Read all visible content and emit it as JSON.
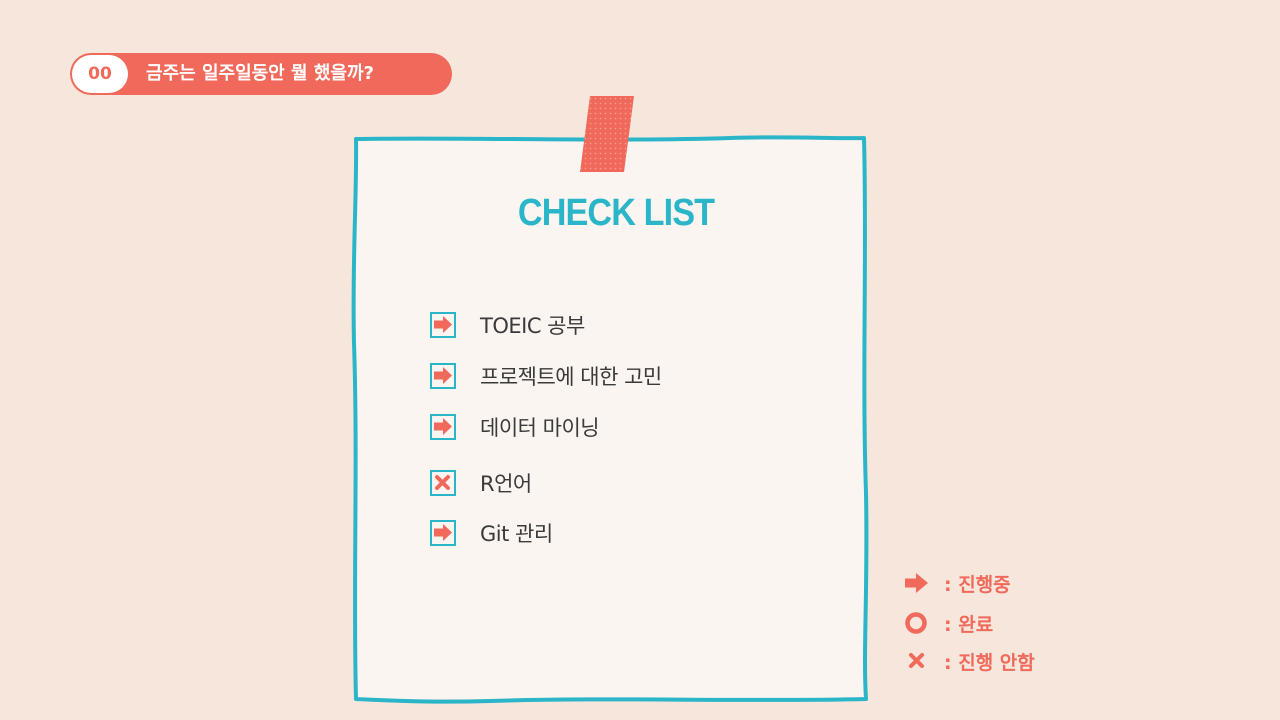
{
  "header": {
    "number": "00",
    "title": "금주는 일주일동안 뭘 했을까?"
  },
  "checklist": {
    "title": "CHECK LIST",
    "items": [
      {
        "label": "TOEIC 공부",
        "status": "in-progress",
        "icon": "arrow-right-icon"
      },
      {
        "label": "프로젝트에 대한 고민",
        "status": "in-progress",
        "icon": "arrow-right-icon"
      },
      {
        "label": "데이터 마이닝",
        "status": "in-progress",
        "icon": "arrow-right-icon"
      },
      {
        "label": "R언어",
        "status": "not-started",
        "icon": "x-mark-icon"
      },
      {
        "label": "Git 관리",
        "status": "in-progress",
        "icon": "arrow-right-icon"
      }
    ]
  },
  "legend": [
    {
      "icon": "arrow-right-icon",
      "label": ": 진행중"
    },
    {
      "icon": "circle-icon",
      "label": ": 완료"
    },
    {
      "icon": "x-mark-icon",
      "label": ": 진행 안함"
    }
  ],
  "colors": {
    "background": "#f6e6dc",
    "accent": "#f0695a",
    "teal": "#2bb5c8",
    "paper": "#faf5f0",
    "text": "#3a3a3a"
  }
}
